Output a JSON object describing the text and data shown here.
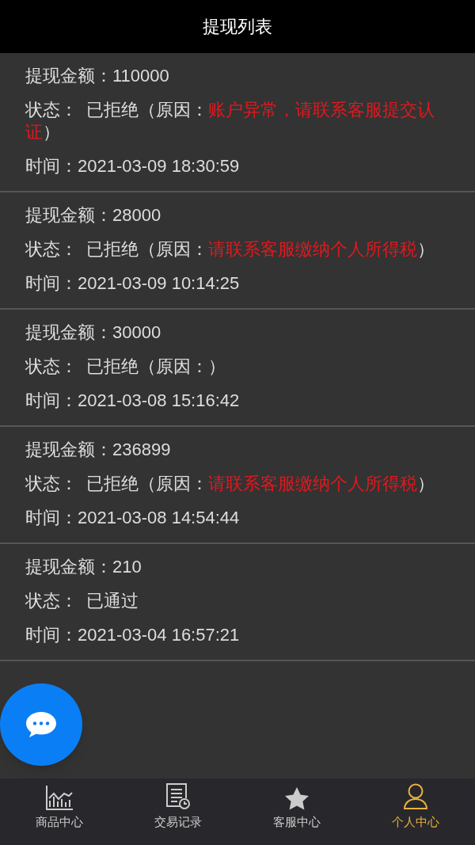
{
  "header": {
    "title": "提现列表"
  },
  "records": [
    {
      "amount_label": "提现金额：",
      "amount": "110000",
      "status_label": "状态：",
      "status": "已拒绝（原因：",
      "reason": "账户异常，请联系客服提交认证",
      "status_end": "）",
      "time_label": "时间：",
      "time": "2021-03-09 18:30:59"
    },
    {
      "amount_label": "提现金额：",
      "amount": "28000",
      "status_label": "状态：",
      "status": "已拒绝（原因：",
      "reason": "请联系客服缴纳个人所得税",
      "status_end": "）",
      "time_label": "时间：",
      "time": "2021-03-09 10:14:25"
    },
    {
      "amount_label": "提现金额：",
      "amount": "30000",
      "status_label": "状态：",
      "status": "已拒绝（原因：",
      "status_end": "）",
      "time_label": "时间：",
      "time": "2021-03-08 15:16:42"
    },
    {
      "amount_label": "提现金额：",
      "amount": "236899",
      "status_label": "状态：",
      "status": "已拒绝（原因：",
      "reason": "请联系客服缴纳个人所得税",
      "status_end": "）",
      "time_label": "时间：",
      "time": "2021-03-08 14:54:44"
    },
    {
      "amount_label": "提现金额：",
      "amount": "210",
      "status_label": "状态：",
      "status": "已通过",
      "time_label": "时间：",
      "time": "2021-03-04 16:57:21"
    }
  ],
  "tabbar": [
    {
      "kind": "chart",
      "label": "商品中心",
      "selected": false
    },
    {
      "kind": "records",
      "label": "交易记录",
      "selected": false
    },
    {
      "kind": "star",
      "label": "客服中心",
      "selected": false
    },
    {
      "kind": "person",
      "label": "个人中心",
      "selected": true
    }
  ]
}
